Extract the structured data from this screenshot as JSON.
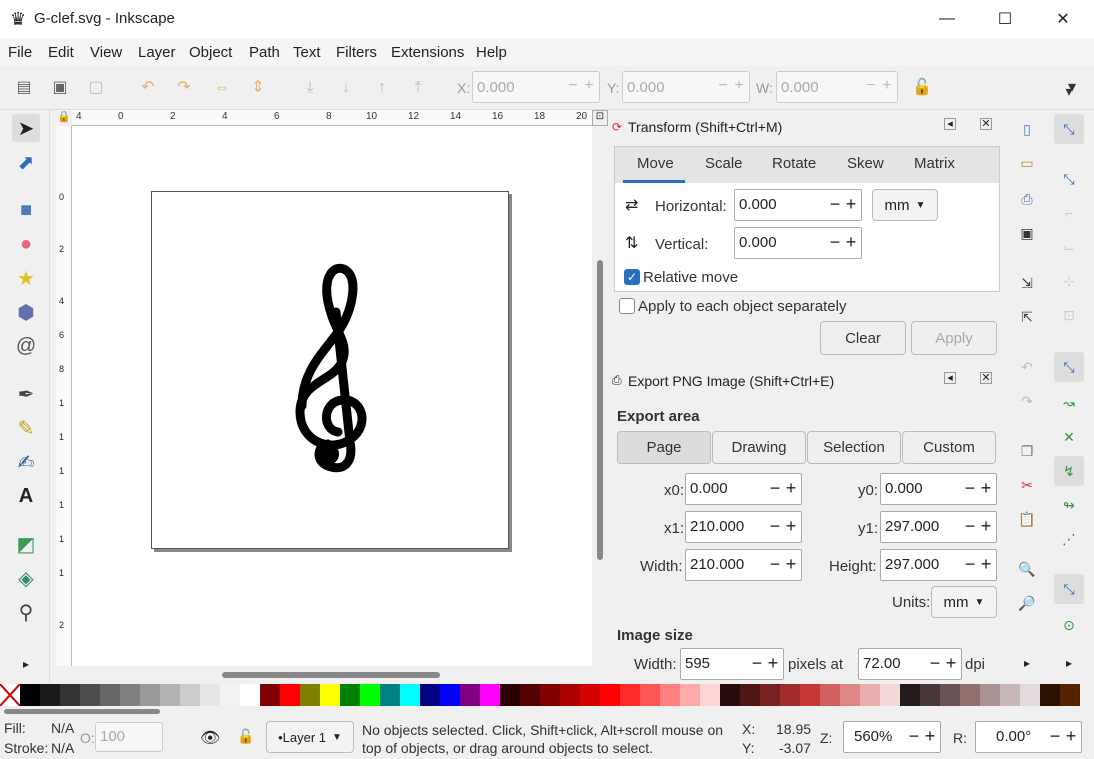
{
  "window": {
    "title": "G-clef.svg - Inkscape",
    "min": "—",
    "max": "☐",
    "close": "✕"
  },
  "menu": [
    "File",
    "Edit",
    "View",
    "Layer",
    "Object",
    "Path",
    "Text",
    "Filters",
    "Extensions",
    "Help"
  ],
  "toolbar": {
    "x_label": "X:",
    "x_value": "0.000",
    "y_label": "Y:",
    "y_value": "0.000",
    "w_label": "W:",
    "w_value": "0.000",
    "overflow": "▾"
  },
  "ruler_h": [
    "4",
    "0",
    "2",
    "4",
    "6",
    "8",
    "10",
    "12",
    "14",
    "16",
    "18",
    "20"
  ],
  "ruler_v": [
    "0",
    "2",
    "4",
    "6",
    "8",
    "1",
    "1",
    "1",
    "1",
    "1",
    "1",
    "2"
  ],
  "transform": {
    "title": "Transform (Shift+Ctrl+M)",
    "tabs": [
      "Move",
      "Scale",
      "Rotate",
      "Skew",
      "Matrix"
    ],
    "horizontal_label": "Horizontal:",
    "horizontal_value": "0.000",
    "vertical_label": "Vertical:",
    "vertical_value": "0.000",
    "unit": "mm",
    "relative_move": "Relative move",
    "apply_each": "Apply to each object separately",
    "clear": "Clear",
    "apply": "Apply"
  },
  "export": {
    "title": "Export PNG Image (Shift+Ctrl+E)",
    "area_heading": "Export area",
    "area_buttons": [
      "Page",
      "Drawing",
      "Selection",
      "Custom"
    ],
    "x0_label": "x0:",
    "x0_value": "0.000",
    "y0_label": "y0:",
    "y0_value": "0.000",
    "x1_label": "x1:",
    "x1_value": "210.000",
    "y1_label": "y1:",
    "y1_value": "297.000",
    "width_label": "Width:",
    "width_value": "210.000",
    "height_label": "Height:",
    "height_value": "297.000",
    "units_label": "Units:",
    "units_value": "mm",
    "image_size_heading": "Image size",
    "img_width_label": "Width:",
    "img_width_value": "595",
    "pixels_at": "pixels at",
    "dpi_value": "72.00",
    "dpi": "dpi"
  },
  "palette": [
    "#000000",
    "#1a1a1a",
    "#333333",
    "#4d4d4d",
    "#666666",
    "#808080",
    "#999999",
    "#b3b3b3",
    "#cccccc",
    "#e6e6e6",
    "#f2f2f2",
    "#ffffff",
    "#800000",
    "#ff0000",
    "#808000",
    "#ffff00",
    "#008000",
    "#00ff00",
    "#008080",
    "#00ffff",
    "#000080",
    "#0000ff",
    "#800080",
    "#ff00ff",
    "#2b0000",
    "#550000",
    "#800000",
    "#aa0000",
    "#d40000",
    "#ff0000",
    "#ff2a2a",
    "#ff5555",
    "#ff8080",
    "#ffaaaa",
    "#ffd5d5",
    "#280b0b",
    "#501616",
    "#782121",
    "#a02c2c",
    "#c83737",
    "#d35f5f",
    "#de8787",
    "#e9afaf",
    "#f4d7d7",
    "#241c1c",
    "#483737",
    "#6c5353",
    "#916f6f",
    "#ac9393",
    "#c8b7b7",
    "#e3dbdb",
    "#2b1100",
    "#552200"
  ],
  "status": {
    "fill_label": "Fill:",
    "fill_value": "N/A",
    "stroke_label": "Stroke:",
    "stroke_value": "N/A",
    "opacity_label": "O:",
    "opacity_value": "100",
    "layer": "•Layer 1",
    "message": "No objects selected. Click, Shift+click, Alt+scroll mouse on top of objects, or drag around objects to select.",
    "x_label": "X:",
    "x_value": "18.95",
    "y_label": "Y:",
    "y_value": "-3.07",
    "zoom_label": "Z:",
    "zoom_value": "560%",
    "rot_label": "R:",
    "rot_value": "0.00°"
  }
}
